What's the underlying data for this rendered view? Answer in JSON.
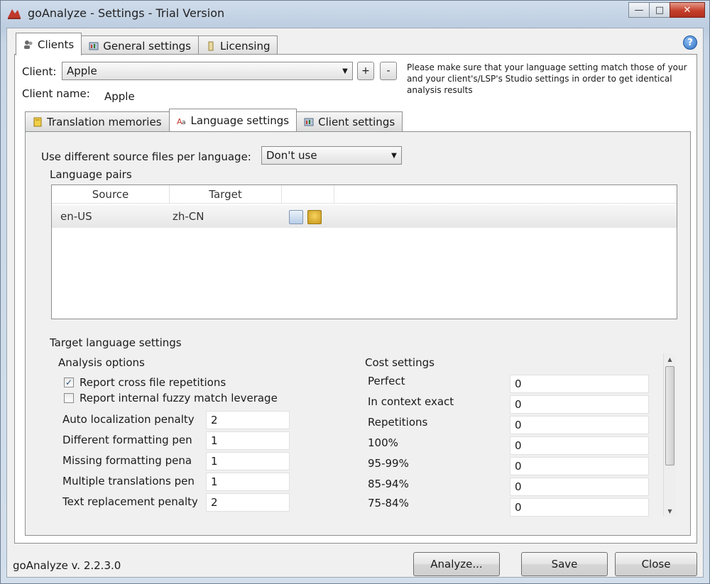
{
  "window": {
    "title": "goAnalyze - Settings - Trial Version",
    "controls": {
      "minimize": "—",
      "maximize": "□",
      "close": "✕"
    }
  },
  "help_icon": "?",
  "top_tabs": [
    {
      "label": "Clients",
      "icon": "people-icon",
      "active": true
    },
    {
      "label": "General settings",
      "icon": "settings-icon",
      "active": false
    },
    {
      "label": "Licensing",
      "icon": "key-icon",
      "active": false
    }
  ],
  "client": {
    "label": "Client:",
    "selected": "Apple",
    "add": "+",
    "remove": "-",
    "name_label": "Client name:",
    "name_value": "Apple",
    "note": "Please make sure that your language setting match those of your and your client's/LSP's Studio settings in order to get identical analysis results"
  },
  "sub_tabs": [
    {
      "label": "Translation memories",
      "icon": "tm-icon",
      "active": false
    },
    {
      "label": "Language settings",
      "icon": "language-icon",
      "active": true
    },
    {
      "label": "Client settings",
      "icon": "settings-icon",
      "active": false
    }
  ],
  "source_files": {
    "label": "Use different source files per language:",
    "selected": "Don't use"
  },
  "language_pairs": {
    "title": "Language pairs",
    "columns": [
      "Source",
      "Target"
    ],
    "rows": [
      {
        "source": "en-US",
        "target": "zh-CN"
      }
    ]
  },
  "target_settings": {
    "title": "Target language settings",
    "analysis_options": {
      "title": "Analysis options",
      "checkboxes": [
        {
          "label": "Report cross file repetitions",
          "checked": true
        },
        {
          "label": "Report internal fuzzy match leverage",
          "checked": false
        }
      ],
      "fields": [
        {
          "label": "Auto localization penalty",
          "value": "2"
        },
        {
          "label": "Different formatting pen",
          "value": "1"
        },
        {
          "label": "Missing formatting pena",
          "value": "1"
        },
        {
          "label": "Multiple translations pen",
          "value": "1"
        },
        {
          "label": "Text replacement penalty",
          "value": "2"
        }
      ]
    },
    "cost_settings": {
      "title": "Cost settings",
      "rows": [
        {
          "label": "Perfect",
          "value": "0"
        },
        {
          "label": "In context exact",
          "value": "0"
        },
        {
          "label": "Repetitions",
          "value": "0"
        },
        {
          "label": "100%",
          "value": "0"
        },
        {
          "label": "95-99%",
          "value": "0"
        },
        {
          "label": "85-94%",
          "value": "0"
        },
        {
          "label": "75-84%",
          "value": "0"
        }
      ]
    }
  },
  "footer": {
    "version": "goAnalyze v. 2.2.3.0",
    "analyze": "Analyze...",
    "save": "Save",
    "close": "Close"
  }
}
